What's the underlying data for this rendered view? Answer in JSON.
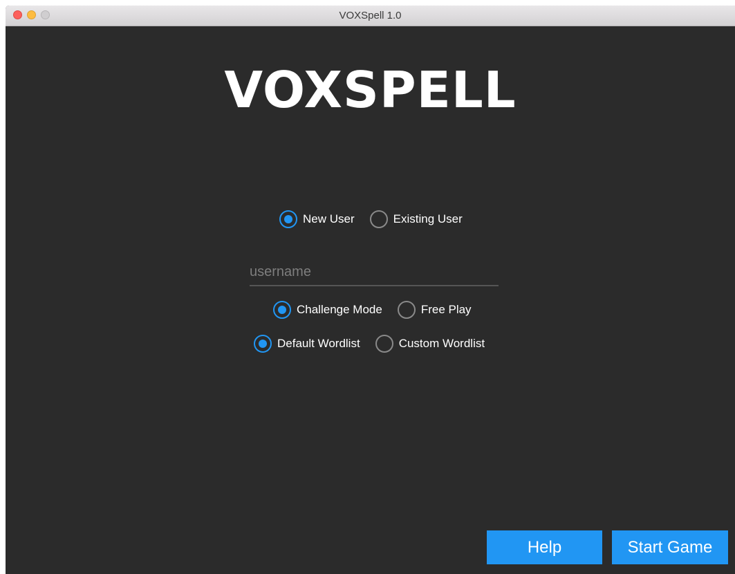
{
  "window": {
    "title": "VOXSpell 1.0"
  },
  "logo": {
    "text": "VOXSPELL"
  },
  "user_type": {
    "options": [
      {
        "label": "New User",
        "selected": true
      },
      {
        "label": "Existing User",
        "selected": false
      }
    ]
  },
  "username": {
    "value": "",
    "placeholder": "username"
  },
  "game_mode": {
    "options": [
      {
        "label": "Challenge Mode",
        "selected": true
      },
      {
        "label": "Free Play",
        "selected": false
      }
    ]
  },
  "wordlist": {
    "options": [
      {
        "label": "Default Wordlist",
        "selected": true
      },
      {
        "label": "Custom Wordlist",
        "selected": false
      }
    ]
  },
  "buttons": {
    "help_label": "Help",
    "start_label": "Start Game"
  },
  "colors": {
    "accent": "#2196f3",
    "background": "#2b2b2b"
  }
}
